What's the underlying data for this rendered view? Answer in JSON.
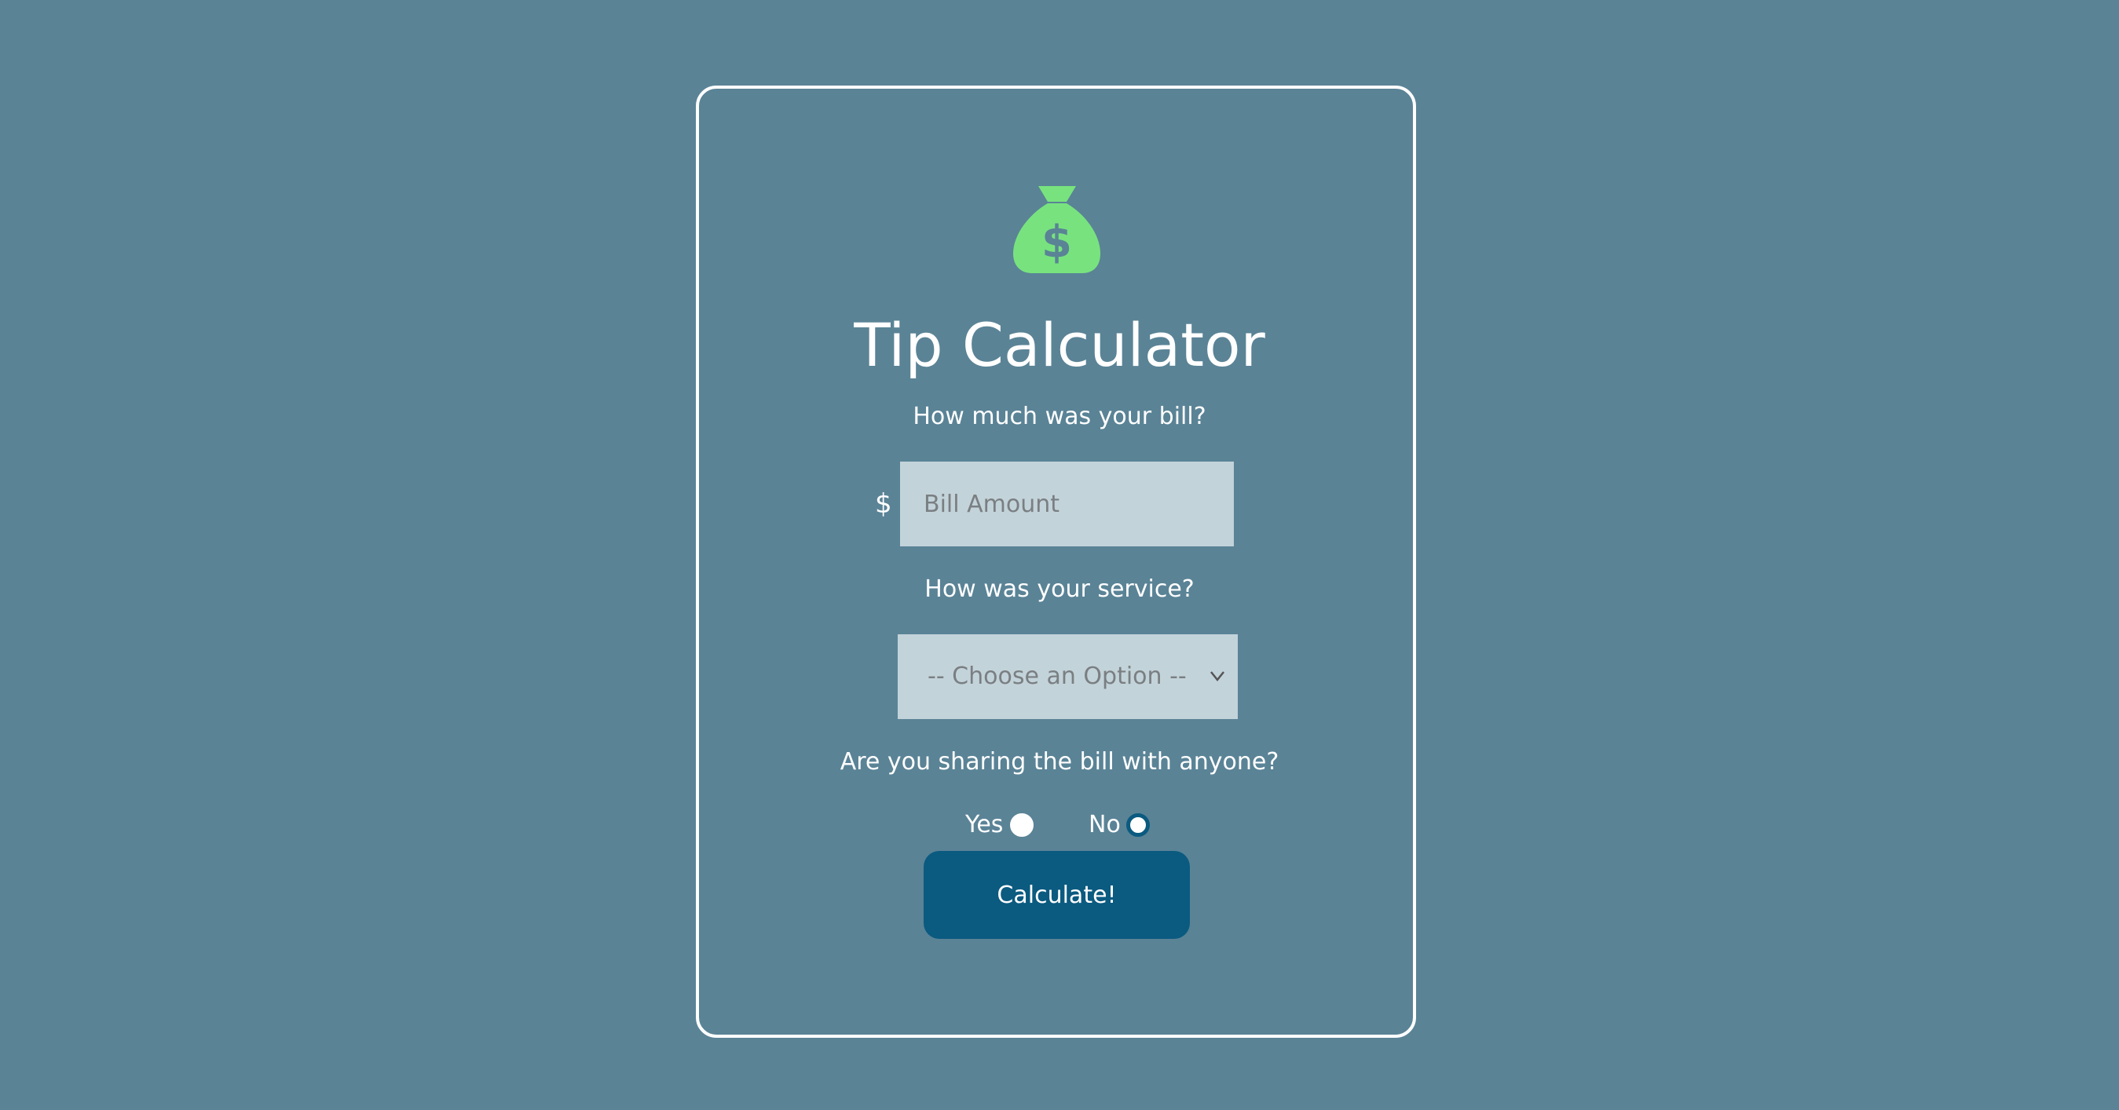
{
  "app": {
    "title": "Tip Calculator",
    "icon": "money-bag-icon",
    "accent_color": "#78e37e",
    "background_color": "#5a8396",
    "button_color": "#0b5a80"
  },
  "bill": {
    "question": "How much was your bill?",
    "currency_symbol": "$",
    "placeholder": "Bill Amount",
    "value": ""
  },
  "service": {
    "question": "How was your service?",
    "selected": "-- Choose an Option --"
  },
  "sharing": {
    "question": "Are you sharing the bill with anyone?",
    "yes_label": "Yes",
    "no_label": "No",
    "selected": "No"
  },
  "actions": {
    "calculate_label": "Calculate!"
  }
}
